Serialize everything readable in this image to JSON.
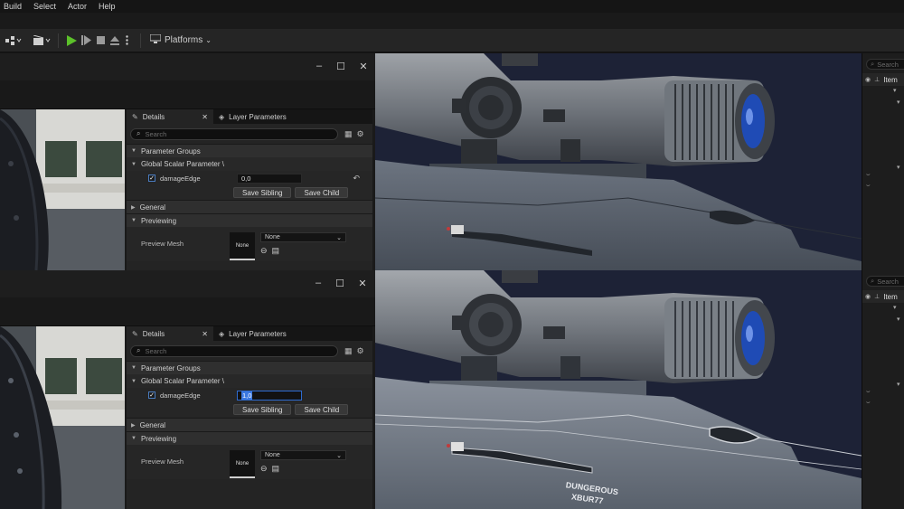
{
  "menu": [
    "Build",
    "Select",
    "Actor",
    "Help"
  ],
  "toolbar": {
    "platforms_label": "Platforms"
  },
  "panels": [
    {
      "window_controls": {
        "minimize": "✕",
        "maximize": "☐",
        "close": "✕"
      },
      "details": {
        "tab_details": "Details",
        "tab_layer": "Layer Parameters",
        "search_placeholder": "Search",
        "group_parameter_groups": "Parameter Groups",
        "subgroup": "Global Scalar Parameter \\",
        "param_name": "damageEdge",
        "param_value": "0,0",
        "button_sibling": "Save Sibling",
        "button_child": "Save Child",
        "cat_general": "General",
        "cat_previewing": "Previewing",
        "preview_mesh_label": "Preview Mesh",
        "thumb_label": "None",
        "dropdown_value": "None"
      }
    },
    {
      "window_controls": {
        "minimize": "✕",
        "maximize": "☐",
        "close": "✕"
      },
      "details": {
        "tab_details": "Details",
        "tab_layer": "Layer Parameters",
        "search_placeholder": "Search",
        "group_parameter_groups": "Parameter Groups",
        "subgroup": "Global Scalar Parameter \\",
        "param_name": "damageEdge",
        "param_value": "1,0",
        "button_sibling": "Save Sibling",
        "button_child": "Save Child",
        "cat_general": "General",
        "cat_previewing": "Previewing",
        "preview_mesh_label": "Preview Mesh",
        "thumb_label": "None",
        "dropdown_value": "None"
      }
    }
  ],
  "outliner": [
    {
      "search_placeholder": "Search",
      "header": "Item"
    },
    {
      "search_placeholder": "Search",
      "header": "Item"
    }
  ],
  "viewport": {
    "engraving_line1": "DUNGEROUS",
    "engraving_line2": "XBUR77"
  },
  "colors": {
    "play_green": "#5cc12a",
    "focus_blue": "#2e6bd0",
    "lens_blue": "#1f4bb5"
  }
}
